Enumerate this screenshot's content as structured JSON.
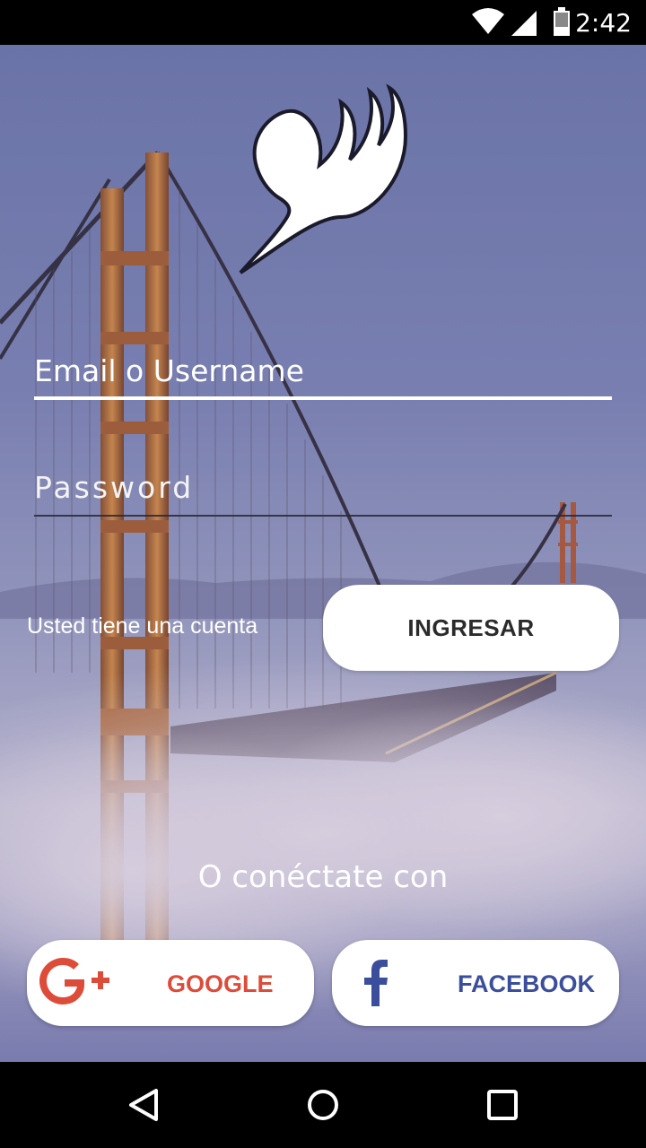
{
  "status_bar": {
    "time": "2:42",
    "icons": [
      "wifi-icon",
      "cell-signal-icon",
      "battery-icon"
    ]
  },
  "logo": {
    "icon": "fairy-tail-emblem"
  },
  "form": {
    "email_placeholder": "Email o Username",
    "password_placeholder": "Password",
    "account_text": "Usted tiene una cuenta",
    "submit_label": "INGRESAR"
  },
  "social": {
    "connect_text": "O conéctate con",
    "google_label": "GOOGLE",
    "facebook_label": "FACEBOOK"
  },
  "nav_bar": {
    "icons": [
      "back-icon",
      "home-icon",
      "recents-icon"
    ]
  },
  "colors": {
    "google": "#dd4b39",
    "facebook": "#3b4e9c",
    "button_bg": "#ffffff",
    "overlay": "#6a6fa8"
  }
}
